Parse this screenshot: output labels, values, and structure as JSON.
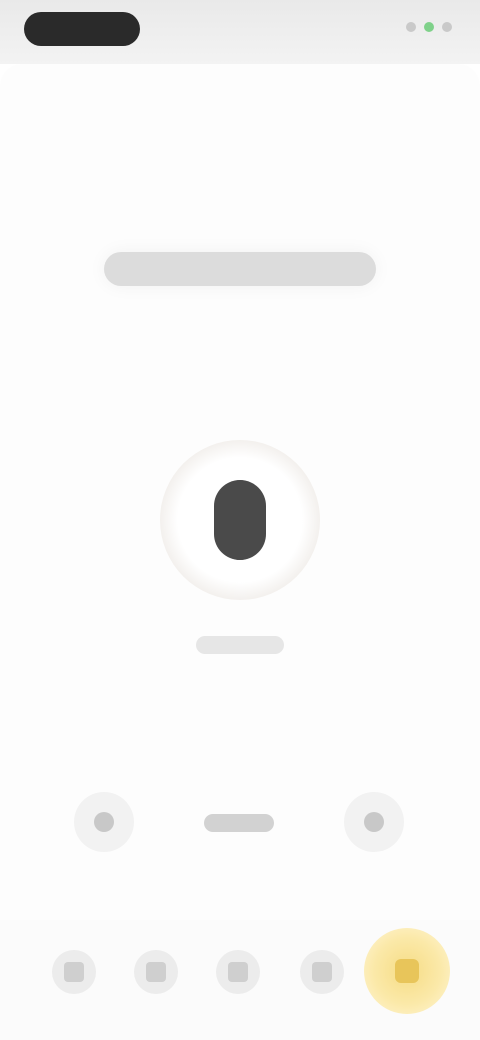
{
  "status_bar": {
    "time": "",
    "icons": [
      "signal-icon",
      "wifi-icon",
      "battery-icon"
    ]
  },
  "main": {
    "heading": "",
    "mic_caption": ""
  },
  "controls": {
    "left_icon": "left-control-icon",
    "center_label": "",
    "right_icon": "right-control-icon"
  },
  "bottom_nav": {
    "items": [
      {
        "icon": "nav-icon-1"
      },
      {
        "icon": "nav-icon-2"
      },
      {
        "icon": "nav-icon-3"
      },
      {
        "icon": "nav-icon-4"
      },
      {
        "icon": "nav-icon-5",
        "active": true
      }
    ]
  },
  "colors": {
    "accent": "#f6dc85",
    "mic": "#4a4a4a"
  }
}
